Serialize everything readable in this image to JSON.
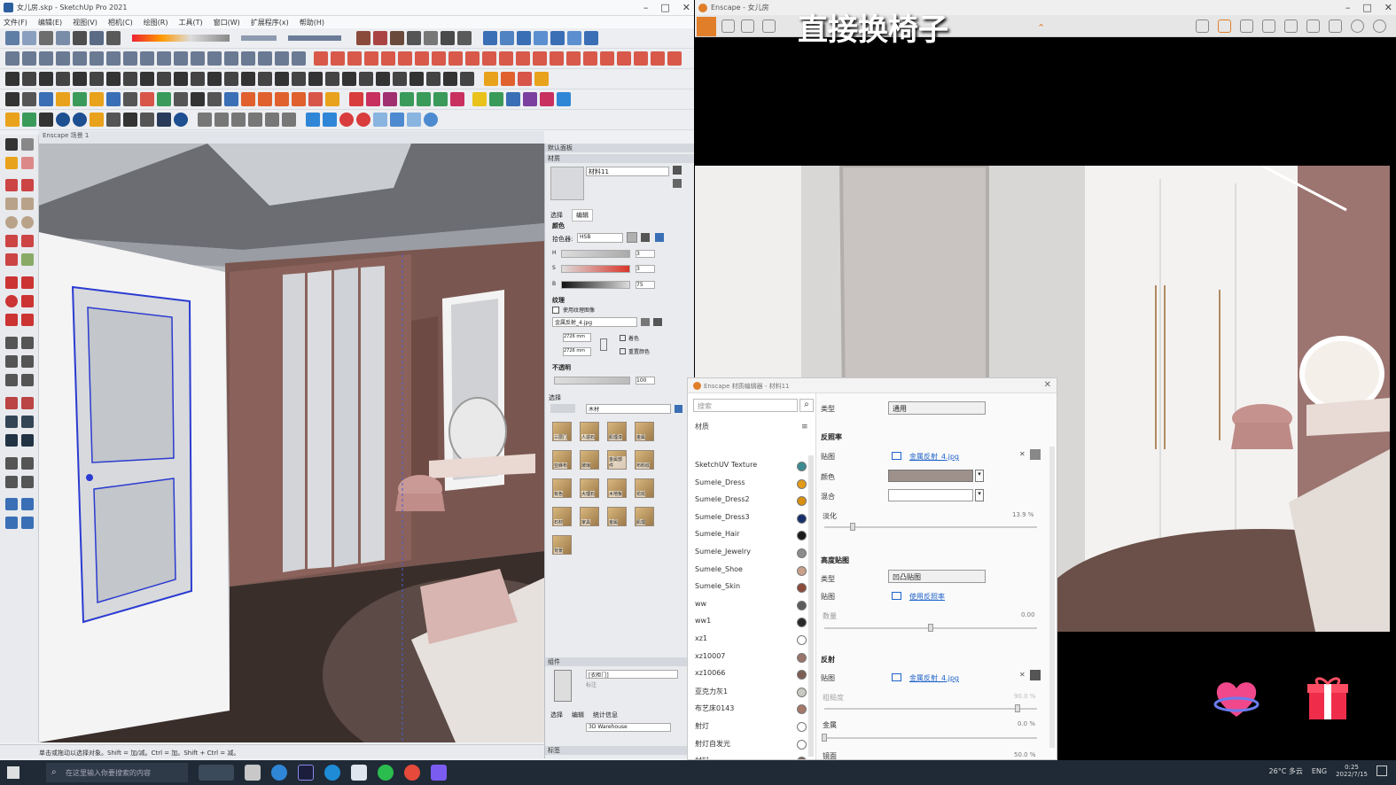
{
  "sketchup": {
    "title": "女儿房.skp - SketchUp Pro 2021",
    "menu": [
      "文件(F)",
      "编辑(E)",
      "视图(V)",
      "相机(C)",
      "绘图(R)",
      "工具(T)",
      "窗口(W)",
      "扩展程序(x)",
      "帮助(H)"
    ],
    "scene_tab": "Enscape 场景 1",
    "status": "单击或拖动以选择对象。Shift = 加/减。Ctrl = 加。Shift + Ctrl = 减。",
    "tray": {
      "header": "默认面板",
      "materials_section": "材质",
      "material_name": "材料11",
      "tabs": [
        "选择",
        "编辑"
      ],
      "color_label": "颜色",
      "picker_label": "拾色器:",
      "picker_value": "HSB",
      "h_label": "H",
      "s_label": "S",
      "b_label": "B",
      "h_value": "3",
      "s_value": "3",
      "b_value": "75",
      "texture_label": "纹理",
      "use_texture": "使用纹理图像",
      "texture_file": "金属反射_4.jpg",
      "width": "2726 mm",
      "height": "2726 mm",
      "colorize": "着色",
      "reset_color": "重置颜色",
      "opacity_label": "不透明",
      "opacity_value": "100",
      "select_label": "选择",
      "library": "木材",
      "swatches": [
        "三层门",
        "人造石",
        "肌理漆",
        "金属",
        "亚麻布",
        "玻璃",
        "金属部件",
        "布料纹",
        "有色",
        "大理石",
        "木地板",
        "花纹",
        "石材",
        "家具",
        "金属",
        "肌理",
        "背景"
      ],
      "bottom_section": "组件",
      "component_name": "[衣柜门]",
      "component_sub": "标注",
      "bottom_tabs": [
        "选择",
        "编辑",
        "统计信息"
      ],
      "bottom_model": "3D Warehouse",
      "bottom_status": "标签"
    }
  },
  "enscape": {
    "title": "Enscape - 女儿房",
    "caption": "直接换椅子",
    "editor": {
      "title": "Enscape 材质编辑器 - 材料11",
      "search_placeholder": "搜索",
      "list_header": "材质",
      "materials": [
        {
          "name": "SketchUV Texture",
          "color": "#3b8b93"
        },
        {
          "name": "Sumele_Dress",
          "color": "#e39b17"
        },
        {
          "name": "Sumele_Dress2",
          "color": "#d9900e"
        },
        {
          "name": "Sumele_Dress3",
          "color": "#15306b"
        },
        {
          "name": "Sumele_Hair",
          "color": "#1a1a1a"
        },
        {
          "name": "Sumele_Jewelry",
          "color": "#8c8c8c"
        },
        {
          "name": "Sumele_Shoe",
          "color": "#c9a089"
        },
        {
          "name": "Sumele_Skin",
          "color": "#8b4a3a"
        },
        {
          "name": "ww",
          "color": "#5b5b5b"
        },
        {
          "name": "ww1",
          "color": "#2a2a2a"
        },
        {
          "name": "xz1",
          "color": "#ffffff"
        },
        {
          "name": "xz10007",
          "color": "#9a7468"
        },
        {
          "name": "xz10066",
          "color": "#7d5e55"
        },
        {
          "name": "亚克力灰1",
          "color": "#c9c9c2"
        },
        {
          "name": "布艺床0143",
          "color": "#a67868"
        },
        {
          "name": "射灯",
          "color": "#ffffff"
        },
        {
          "name": "射灯自发光",
          "color": "#ffffff"
        },
        {
          "name": "材料",
          "color": "#7d6660"
        }
      ],
      "type_label": "类型",
      "type_value": "通用",
      "albedo_section": "反照率",
      "texture_label": "贴图",
      "albedo_file": "金属反射_4.jpg",
      "tint_label": "颜色",
      "mix_label": "混合",
      "fade_label": "淡化",
      "fade_value": "13.9 %",
      "bump_section": "高度贴图",
      "bump_type_label": "类型",
      "bump_type_value": "凹凸贴图",
      "bump_tex_label": "贴图",
      "bump_link": "使用反照率",
      "bump_amount_label": "数量",
      "bump_amount": "0.00",
      "refl_section": "反射",
      "refl_tex_label": "贴图",
      "refl_file": "金属反射_4.jpg",
      "rough_label": "粗糙度",
      "rough_value": "90.0 %",
      "metal_label": "金属",
      "metal_value": "0.0 %",
      "spec_label": "镜面",
      "spec_value": "50.0 %"
    }
  },
  "taskbar": {
    "search_placeholder": "在这里输入你要搜索的内容",
    "weather": "26°C 多云",
    "lang": "ENG",
    "time": "0:25",
    "date": "2022/7/15"
  }
}
